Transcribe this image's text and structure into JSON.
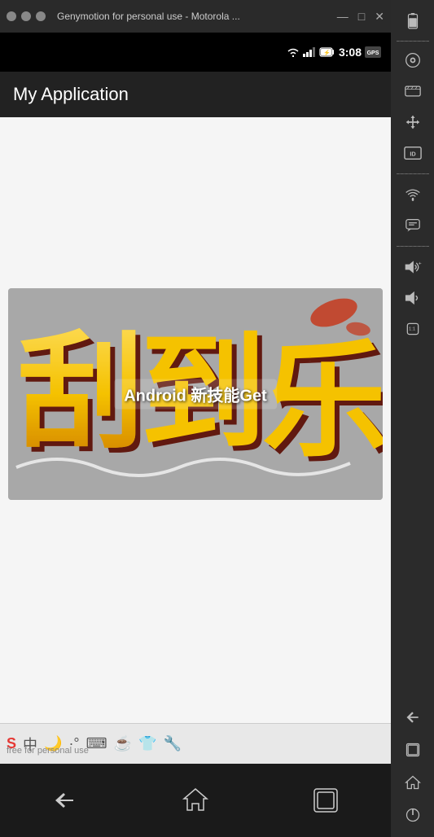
{
  "titlebar": {
    "title": "Genymotion for personal use - Motorola ...",
    "minimize": "—",
    "maximize": "□",
    "close": "✕"
  },
  "statusbar": {
    "time": "3:08"
  },
  "appbar": {
    "title": "My Application"
  },
  "overlay": {
    "text": "Android 新技能Get"
  },
  "watermark": {
    "text": "free for personal use"
  },
  "sidebar": {
    "icons": [
      {
        "name": "battery-icon",
        "symbol": "🔋"
      },
      {
        "name": "camera-icon",
        "symbol": "📷"
      },
      {
        "name": "video-icon",
        "symbol": "🎬"
      },
      {
        "name": "move-icon",
        "symbol": "✥"
      },
      {
        "name": "id-icon",
        "symbol": "ID"
      },
      {
        "name": "wifi-icon",
        "symbol": "📶"
      },
      {
        "name": "chat-icon",
        "symbol": "💬"
      },
      {
        "name": "volume-up-icon",
        "symbol": "🔊+"
      },
      {
        "name": "volume-down-icon",
        "symbol": "🔉"
      },
      {
        "name": "rotate-icon",
        "symbol": "⟳"
      }
    ],
    "bottom": [
      {
        "name": "back-nav-icon",
        "symbol": "↩"
      },
      {
        "name": "recents-nav-icon",
        "symbol": "⊡"
      },
      {
        "name": "home-nav-icon",
        "symbol": "⌂"
      },
      {
        "name": "power-icon",
        "symbol": "⏻"
      }
    ]
  },
  "ime": {
    "icons": [
      "S",
      "中",
      "🌙",
      "⌨",
      "☕",
      "👕",
      "🔧"
    ]
  },
  "navbar": {
    "back": "←",
    "home": "⬡",
    "recents": "⬛"
  }
}
